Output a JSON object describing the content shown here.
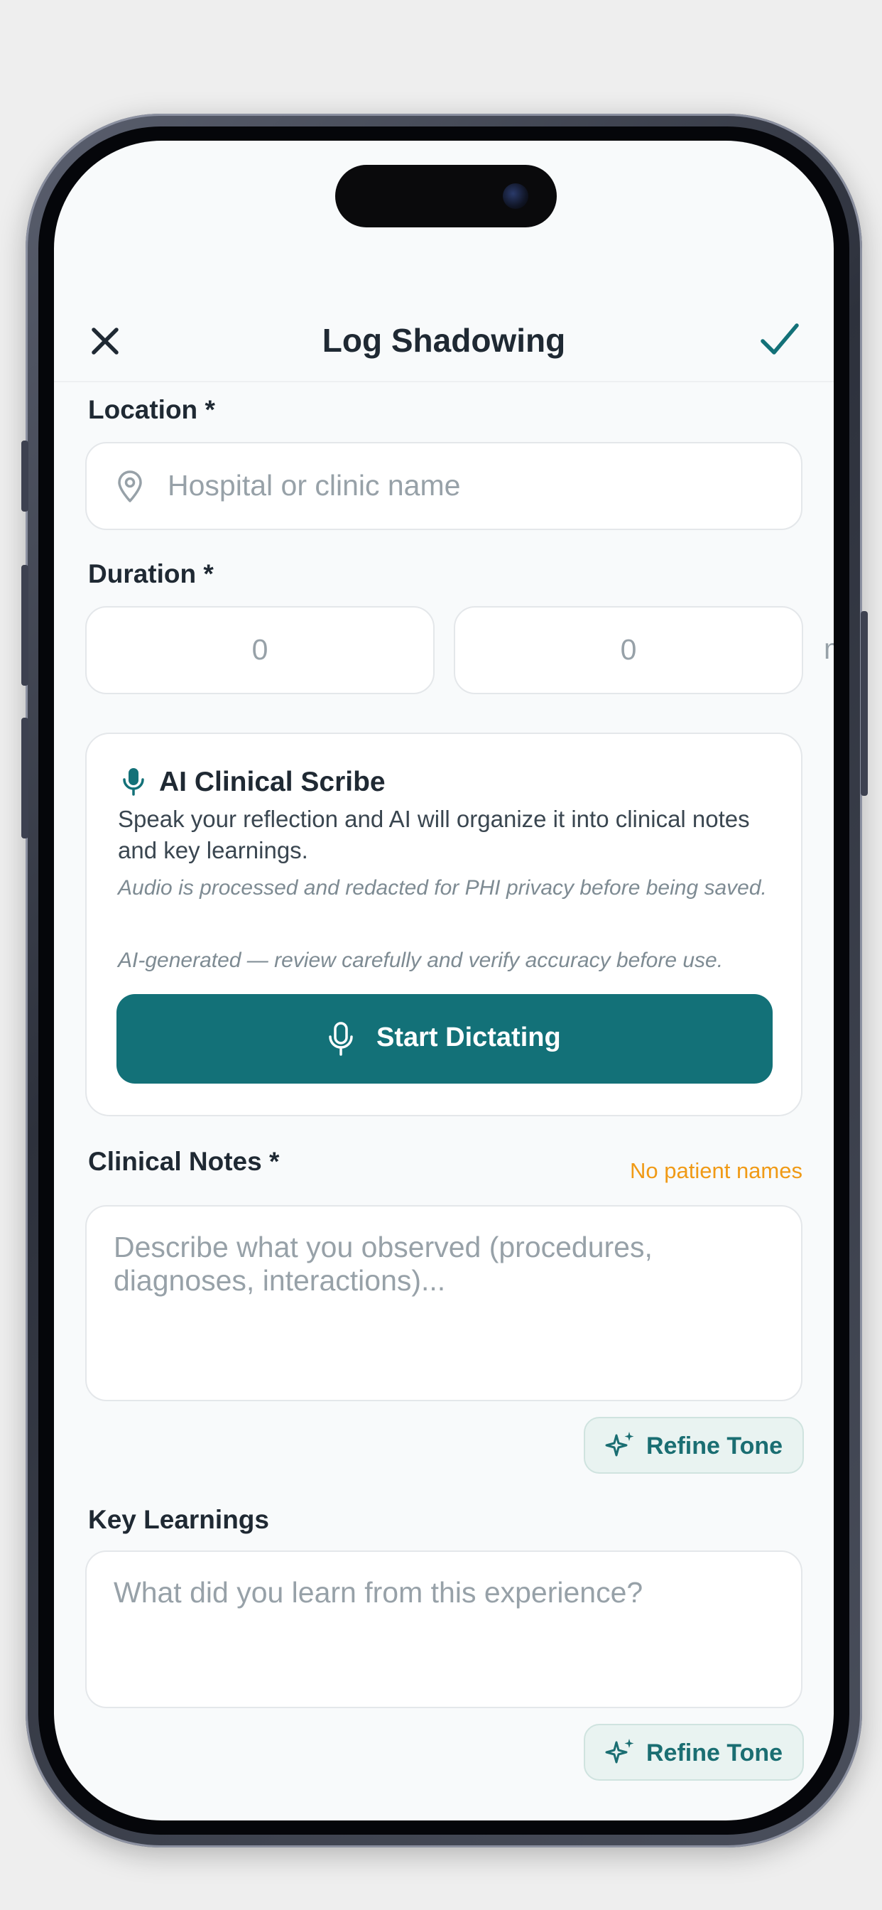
{
  "header": {
    "title": "Log Shadowing"
  },
  "location": {
    "label": "Location *",
    "placeholder": "Hospital or clinic name"
  },
  "duration": {
    "label": "Duration *",
    "hours_placeholder": "0",
    "minutes_placeholder": "0",
    "overflow_text": "m"
  },
  "scribe": {
    "title": "AI Clinical Scribe",
    "description": "Speak your reflection and AI will organize it into clinical notes and key learnings.",
    "privacy_note": "Audio is processed and redacted for PHI privacy before being saved.",
    "disclaimer": "AI-generated — review carefully and verify accuracy before use.",
    "button_label": "Start Dictating"
  },
  "clinical_notes": {
    "label": "Clinical Notes *",
    "warning": "No patient names",
    "placeholder": "Describe what you observed (procedures, diagnoses, interactions)...",
    "refine_label": "Refine Tone"
  },
  "key_learnings": {
    "label": "Key Learnings",
    "placeholder": "What did you learn from this experience?",
    "refine_label": "Refine Tone"
  },
  "colors": {
    "accent": "#137178",
    "warning": "#f09a16",
    "background": "#f8fafb"
  }
}
